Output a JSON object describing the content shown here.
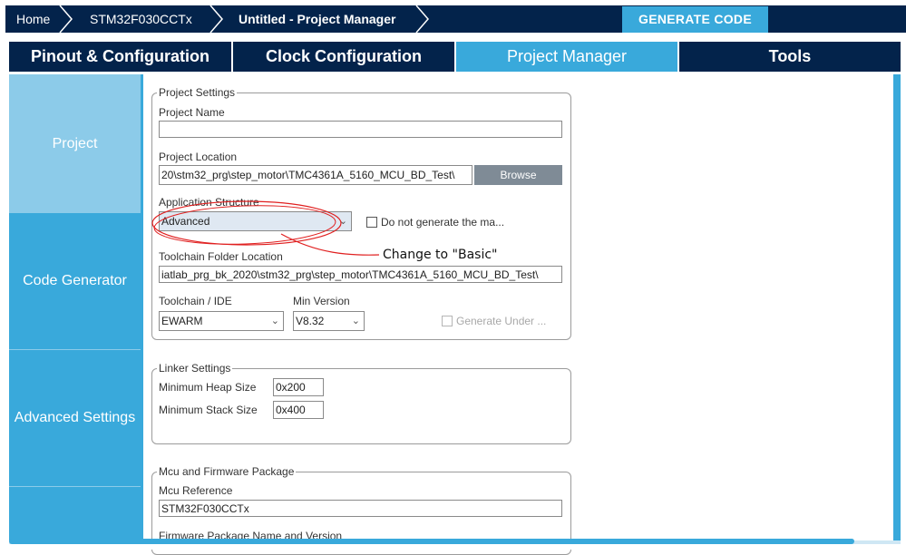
{
  "breadcrumb": {
    "items": [
      "Home",
      "STM32F030CCTx",
      "Untitled - Project Manager"
    ]
  },
  "toolbar": {
    "generate_label": "GENERATE CODE"
  },
  "tabs": [
    {
      "label": "Pinout & Configuration"
    },
    {
      "label": "Clock Configuration"
    },
    {
      "label": "Project Manager"
    },
    {
      "label": "Tools"
    }
  ],
  "sidebar": {
    "items": [
      {
        "label": "Project"
      },
      {
        "label": "Code Generator"
      },
      {
        "label": "Advanced Settings"
      }
    ]
  },
  "project_settings": {
    "legend": "Project Settings",
    "name_label": "Project Name",
    "name_value": "",
    "location_label": "Project Location",
    "location_value": "20\\stm32_prg\\step_motor\\TMC4361A_5160_MCU_BD_Test\\",
    "browse_label": "Browse",
    "app_structure_label": "Application Structure",
    "app_structure_value": "Advanced",
    "no_main_label": "Do not generate the ma...",
    "toolchain_folder_label": "Toolchain Folder Location",
    "toolchain_folder_value": "iatlab_prg_bk_2020\\stm32_prg\\step_motor\\TMC4361A_5160_MCU_BD_Test\\",
    "toolchain_ide_label": "Toolchain / IDE",
    "toolchain_ide_value": "EWARM",
    "min_version_label": "Min Version",
    "min_version_value": "V8.32",
    "generate_under_label": "Generate Under ..."
  },
  "annotation": {
    "text": "Change to \"Basic\""
  },
  "linker_settings": {
    "legend": "Linker Settings",
    "heap_label": "Minimum Heap Size",
    "heap_value": "0x200",
    "stack_label": "Minimum Stack Size",
    "stack_value": "0x400"
  },
  "mcu_firmware": {
    "legend": "Mcu and Firmware Package",
    "mcu_ref_label": "Mcu Reference",
    "mcu_ref_value": "STM32F030CCTx",
    "fw_label": "Firmware Package Name and Version"
  },
  "colors": {
    "navy": "#03234b",
    "accent": "#39a9db",
    "sidebar_selected": "#8ccbe9",
    "annotation_red": "#e02020"
  }
}
